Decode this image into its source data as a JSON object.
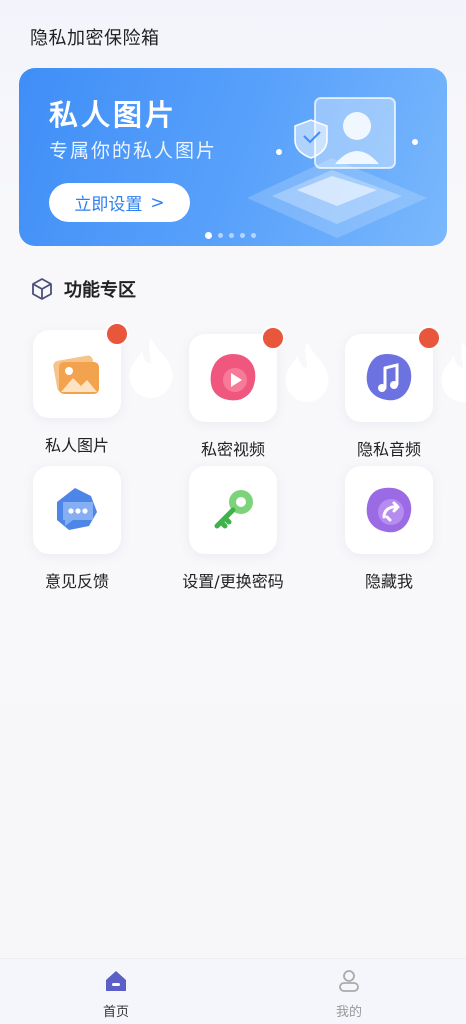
{
  "header": {
    "title": "隐私加密保险箱"
  },
  "banner": {
    "title": "私人图片",
    "subtitle": "专属你的私人图片",
    "button_label": "立即设置",
    "button_chevron": ">",
    "page_count": 5,
    "active_page": 1
  },
  "section": {
    "title": "功能专区",
    "icon": "cube-icon"
  },
  "features": [
    {
      "label": "私人图片",
      "icon": "image-icon",
      "hot": true
    },
    {
      "label": "私密视频",
      "icon": "play-icon",
      "hot": true
    },
    {
      "label": "隐私音频",
      "icon": "music-icon",
      "hot": true
    },
    {
      "label": "意见反馈",
      "icon": "chat-icon",
      "hot": false
    },
    {
      "label": "设置/更换密码",
      "icon": "key-icon",
      "hot": false
    },
    {
      "label": "隐藏我",
      "icon": "hide-icon",
      "hot": false
    }
  ],
  "nav": {
    "home": {
      "label": "首页",
      "active": true
    },
    "mine": {
      "label": "我的",
      "active": false
    }
  },
  "colors": {
    "accent": "#3f8ef7",
    "hot": "#e8563c"
  }
}
